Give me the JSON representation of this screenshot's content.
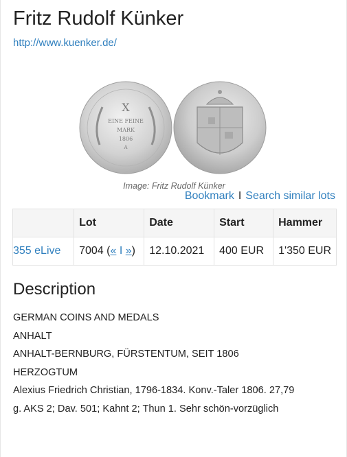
{
  "auction": {
    "title": "Fritz Rudolf Künker",
    "url": "http://www.kuenker.de/"
  },
  "image": {
    "credit": "Image: Fritz Rudolf Künker",
    "obverse_text": [
      "X",
      "EINE FEINE",
      "MARK",
      "1806",
      "A"
    ]
  },
  "actions": {
    "bookmark": "Bookmark",
    "separator": "I",
    "search_similar": "Search similar lots"
  },
  "table": {
    "headers": [
      "",
      "Lot",
      "Date",
      "Start",
      "Hammer"
    ],
    "row": {
      "elive": "355 eLive",
      "lot_number": "7004",
      "nav_open": "(",
      "prev": "«",
      "nav_mid": "I",
      "next": "»",
      "nav_close": ")",
      "date": "12.10.2021",
      "start": "400 EUR",
      "hammer": "1'350 EUR"
    }
  },
  "description": {
    "heading": "Description",
    "category": "GERMAN COINS AND MEDALS",
    "region": "ANHALT",
    "subregion_words": [
      "ANHALT-BERNBURG,",
      "FÜRSTENTUM,",
      "SEIT",
      "1806"
    ],
    "subregion_tail": "HERZOGTUM",
    "text_line1": "Alexius Friedrich Christian, 1796-1834. Konv.-Taler 1806. 27,79",
    "text_line2": "g. AKS 2; Dav. 501; Kahnt 2; Thun 1. Sehr schön-vorzüglich"
  },
  "colors": {
    "link": "#2f7fbe",
    "coin_silver": "#c9c9c9",
    "table_header_bg": "#f5f5f5"
  }
}
